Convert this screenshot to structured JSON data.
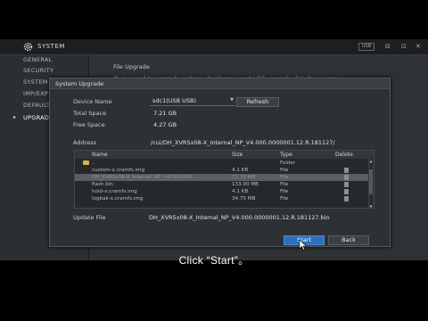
{
  "window": {
    "title": "SYSTEM",
    "usr_badge": "USB",
    "controls": [
      "⊟",
      "⊡",
      "✕"
    ]
  },
  "sidebar": {
    "items": [
      {
        "label": "GENERAL"
      },
      {
        "label": "SECURITY"
      },
      {
        "label": "SYSTEM"
      },
      {
        "label": "IMP/EXP"
      },
      {
        "label": "DEFAULT"
      },
      {
        "label": "UPGRADE"
      }
    ],
    "active_index": 5
  },
  "background": {
    "section_label": "File Upgrade",
    "hint": "If you need to upgrade system,pls please insert USB upgrade disk then press"
  },
  "dialog": {
    "title": "System Upgrade",
    "device_name_label": "Device Name",
    "device_name_value": "sdc1(USB USB)",
    "refresh_label": "Refresh",
    "total_space_label": "Total Space",
    "total_space_value": "7.21 GB",
    "free_space_label": "Free Space",
    "free_space_value": "4.27 GB",
    "address_label": "Address",
    "address_value": "/cui/DH_XVR5x08-X_Internal_NP_V4.000.0000001.12.R.181127/",
    "table": {
      "headers": {
        "name": "Name",
        "size": "Size",
        "type": "Type",
        "delete": "Delete"
      },
      "rows": [
        {
          "name": "..",
          "size": "",
          "type": "Folder",
          "is_folder": true,
          "selected": false
        },
        {
          "name": "custom-x.cramfs.img",
          "size": "4.1 KB",
          "type": "File",
          "is_folder": false,
          "selected": false
        },
        {
          "name": "DH_XVR5x08-X_Internal_NP_V4.000.000...",
          "size": "71.78 MB",
          "type": "File",
          "is_folder": false,
          "selected": true
        },
        {
          "name": "flash.bin",
          "size": "133.00 MB",
          "type": "File",
          "is_folder": false,
          "selected": false
        },
        {
          "name": "hoid-x.cramfs.img",
          "size": "4.1 KB",
          "type": "File",
          "is_folder": false,
          "selected": false
        },
        {
          "name": "logbak-x.cramfs.img",
          "size": "34.75 MB",
          "type": "File",
          "is_folder": false,
          "selected": false
        }
      ]
    },
    "update_file_label": "Update File",
    "update_file_value": "DH_XVR5x08-X_Internal_NP_V4.000.0000001.12.R.181127.bin",
    "start_label": "Start",
    "back_label": "Back"
  },
  "caption": "Click “Start”。",
  "colors": {
    "accent": "#2e6fb8",
    "folder": "#d9b44a",
    "selected_row": "#5a5e64"
  }
}
